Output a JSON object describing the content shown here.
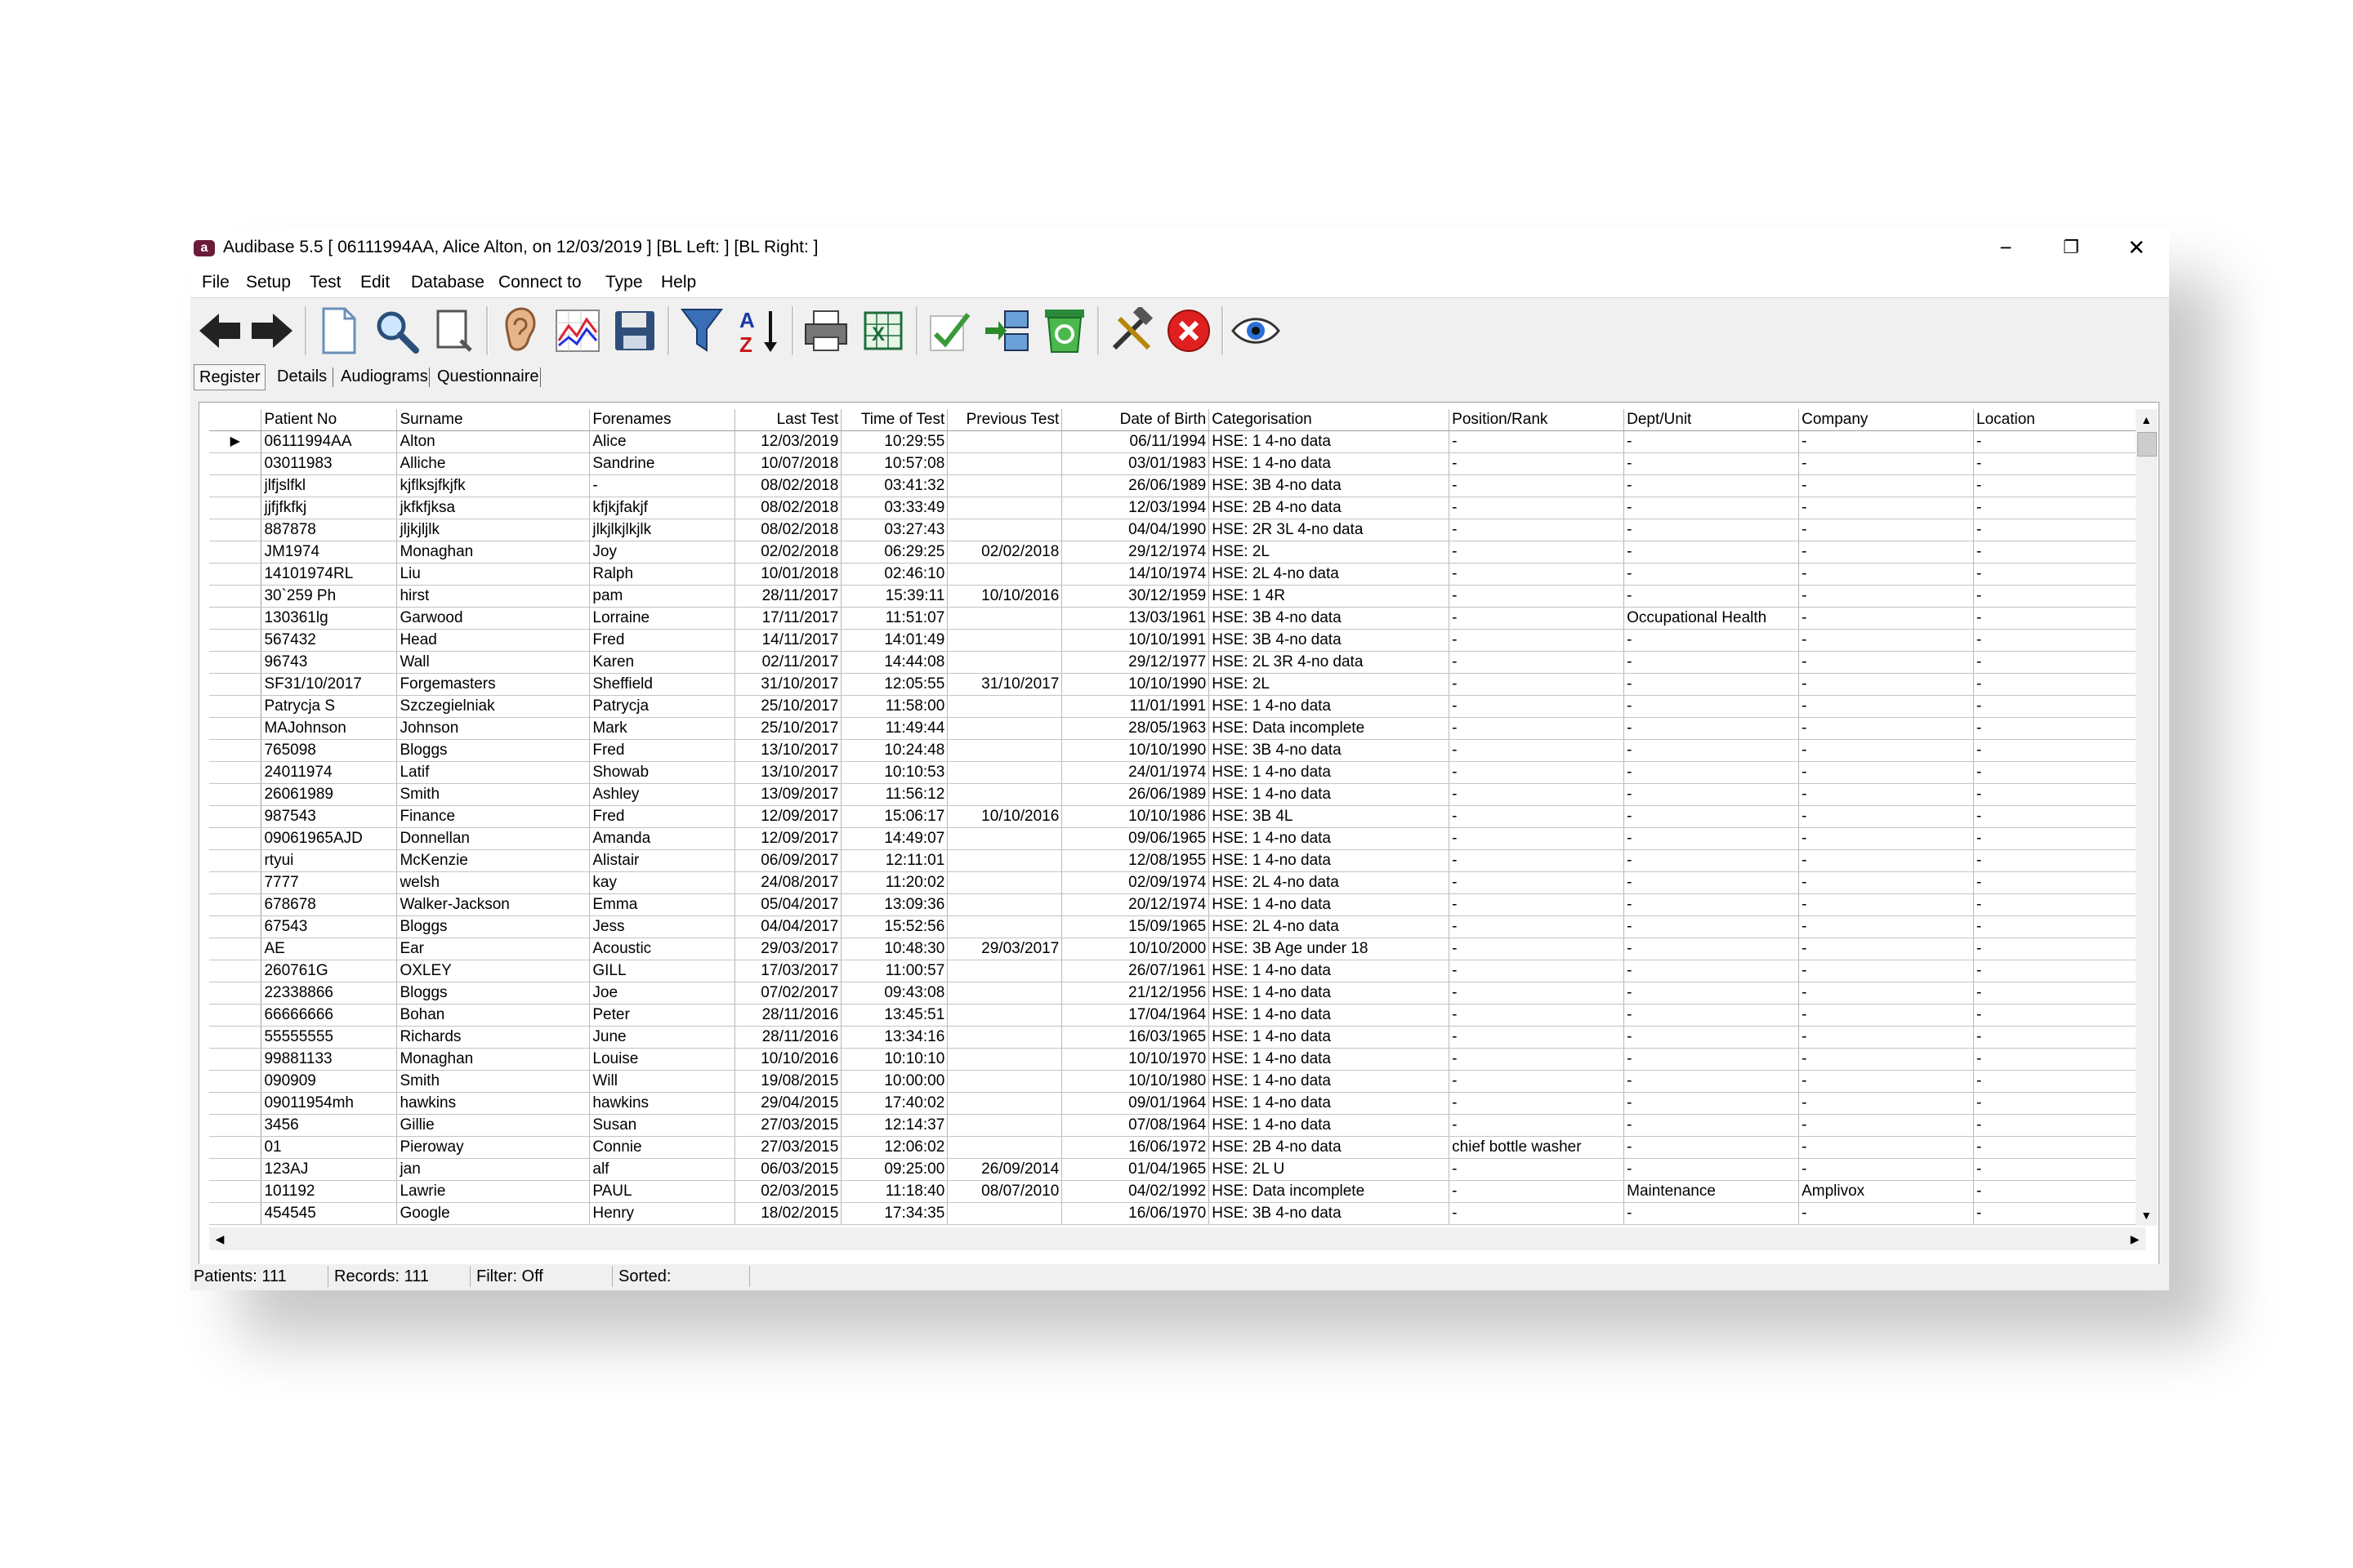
{
  "window": {
    "title": "Audibase 5.5 [ 06111994AA, Alice Alton, on 12/03/2019 ] [BL Left:  ] [BL Right:  ]",
    "app_icon_letter": "a",
    "controls": {
      "minimize": "−",
      "restore": "❐",
      "close": "✕"
    }
  },
  "menu": [
    "File",
    "Setup",
    "Test",
    "Edit",
    "Database",
    "Connect to",
    "Type",
    "Help"
  ],
  "toolbar": [
    {
      "name": "back-icon"
    },
    {
      "name": "forward-icon"
    },
    {
      "name": "new-document-icon"
    },
    {
      "name": "search-icon"
    },
    {
      "name": "preview-icon"
    },
    {
      "name": "ear-icon"
    },
    {
      "name": "audiogram-chart-icon"
    },
    {
      "name": "save-icon"
    },
    {
      "name": "filter-icon"
    },
    {
      "name": "sort-az-icon"
    },
    {
      "name": "print-icon"
    },
    {
      "name": "excel-export-icon"
    },
    {
      "name": "check-icon"
    },
    {
      "name": "transfer-icon"
    },
    {
      "name": "recycle-icon"
    },
    {
      "name": "tools-icon"
    },
    {
      "name": "cancel-icon"
    },
    {
      "name": "view-eye-icon"
    }
  ],
  "tabs": [
    "Register",
    "Details",
    "Audiograms",
    "Questionnaire"
  ],
  "grid": {
    "columns": [
      "Patient No",
      "Surname",
      "Forenames",
      "Last Test",
      "Time of Test",
      "Previous Test",
      "Date of Birth",
      "Categorisation",
      "Position/Rank",
      "Dept/Unit",
      "Company",
      "Location"
    ],
    "rows": [
      [
        "06111994AA",
        "Alton",
        "Alice",
        "12/03/2019",
        "10:29:55",
        "",
        "06/11/1994",
        "HSE:  1 4-no data",
        "-",
        "-",
        "-",
        "-"
      ],
      [
        "03011983",
        "Alliche",
        "Sandrine",
        "10/07/2018",
        "10:57:08",
        "",
        "03/01/1983",
        "HSE:  1 4-no data",
        "-",
        "-",
        "-",
        "-"
      ],
      [
        "jlfjslfkl",
        "kjflksjfkjfk",
        "-",
        "08/02/2018",
        "03:41:32",
        "",
        "26/06/1989",
        "HSE:  3B 4-no data",
        "-",
        "-",
        "-",
        "-"
      ],
      [
        "jjfjfkfkj",
        "jkfkfjksa",
        "kfjkjfakjf",
        "08/02/2018",
        "03:33:49",
        "",
        "12/03/1994",
        "HSE:  2B 4-no data",
        "-",
        "-",
        "-",
        "-"
      ],
      [
        "887878",
        "jljkjljlk",
        "jlkjlkjlkjlk",
        "08/02/2018",
        "03:27:43",
        "",
        "04/04/1990",
        "HSE:  2R 3L 4-no data",
        "-",
        "-",
        "-",
        "-"
      ],
      [
        "JM1974",
        "Monaghan",
        "Joy",
        "02/02/2018",
        "06:29:25",
        "02/02/2018",
        "29/12/1974",
        "HSE:  2L",
        "-",
        "-",
        "-",
        "-"
      ],
      [
        "14101974RL",
        "Liu",
        "Ralph",
        "10/01/2018",
        "02:46:10",
        "",
        "14/10/1974",
        "HSE:  2L 4-no data",
        "-",
        "-",
        "-",
        "-"
      ],
      [
        "30`259 Ph",
        "hirst",
        "pam",
        "28/11/2017",
        "15:39:11",
        "10/10/2016",
        "30/12/1959",
        "HSE:  1 4R",
        "-",
        "-",
        "-",
        "-"
      ],
      [
        "130361lg",
        "Garwood",
        "Lorraine",
        "17/11/2017",
        "11:51:07",
        "",
        "13/03/1961",
        "HSE:  3B 4-no data",
        "-",
        "Occupational Health",
        "-",
        "-"
      ],
      [
        "567432",
        "Head",
        "Fred",
        "14/11/2017",
        "14:01:49",
        "",
        "10/10/1991",
        "HSE:  3B 4-no data",
        "-",
        "-",
        "-",
        "-"
      ],
      [
        "96743",
        "Wall",
        "Karen",
        "02/11/2017",
        "14:44:08",
        "",
        "29/12/1977",
        "HSE:  2L 3R 4-no data",
        "-",
        "-",
        "-",
        "-"
      ],
      [
        "SF31/10/2017",
        "Forgemasters",
        "Sheffield",
        "31/10/2017",
        "12:05:55",
        "31/10/2017",
        "10/10/1990",
        "HSE:  2L",
        "-",
        "-",
        "-",
        "-"
      ],
      [
        "Patrycja S",
        "Szczegielniak",
        "Patrycja",
        "25/10/2017",
        "11:58:00",
        "",
        "11/01/1991",
        "HSE:  1 4-no data",
        "-",
        "-",
        "-",
        "-"
      ],
      [
        "MAJohnson",
        "Johnson",
        "Mark",
        "25/10/2017",
        "11:49:44",
        "",
        "28/05/1963",
        "HSE: Data incomplete",
        "-",
        "-",
        "-",
        "-"
      ],
      [
        "765098",
        "Bloggs",
        "Fred",
        "13/10/2017",
        "10:24:48",
        "",
        "10/10/1990",
        "HSE:  3B 4-no data",
        "-",
        "-",
        "-",
        "-"
      ],
      [
        "24011974",
        "Latif",
        "Showab",
        "13/10/2017",
        "10:10:53",
        "",
        "24/01/1974",
        "HSE:  1 4-no data",
        "-",
        "-",
        "-",
        "-"
      ],
      [
        "26061989",
        "Smith",
        "Ashley",
        "13/09/2017",
        "11:56:12",
        "",
        "26/06/1989",
        "HSE:  1 4-no data",
        "-",
        "-",
        "-",
        "-"
      ],
      [
        "987543",
        "Finance",
        "Fred",
        "12/09/2017",
        "15:06:17",
        "10/10/2016",
        "10/10/1986",
        "HSE:  3B 4L",
        "-",
        "-",
        "-",
        "-"
      ],
      [
        "09061965AJD",
        "Donnellan",
        "Amanda",
        "12/09/2017",
        "14:49:07",
        "",
        "09/06/1965",
        "HSE:  1 4-no data",
        "-",
        "-",
        "-",
        "-"
      ],
      [
        "rtyui",
        "McKenzie",
        "Alistair",
        "06/09/2017",
        "12:11:01",
        "",
        "12/08/1955",
        "HSE:  1 4-no data",
        "-",
        "-",
        "-",
        "-"
      ],
      [
        "7777",
        "welsh",
        "kay",
        "24/08/2017",
        "11:20:02",
        "",
        "02/09/1974",
        "HSE:  2L 4-no data",
        "-",
        "-",
        "-",
        "-"
      ],
      [
        "678678",
        "Walker-Jackson",
        "Emma",
        "05/04/2017",
        "13:09:36",
        "",
        "20/12/1974",
        "HSE:  1 4-no data",
        "-",
        "-",
        "-",
        "-"
      ],
      [
        "67543",
        "Bloggs",
        "Jess",
        "04/04/2017",
        "15:52:56",
        "",
        "15/09/1965",
        "HSE:  2L 4-no data",
        "-",
        "-",
        "-",
        "-"
      ],
      [
        "AE",
        "Ear",
        "Acoustic",
        "29/03/2017",
        "10:48:30",
        "29/03/2017",
        "10/10/2000",
        "HSE:  3B  Age under 18",
        "-",
        "-",
        "-",
        "-"
      ],
      [
        "260761G",
        "OXLEY",
        "GILL",
        "17/03/2017",
        "11:00:57",
        "",
        "26/07/1961",
        "HSE:  1 4-no data",
        "-",
        "-",
        "-",
        "-"
      ],
      [
        "22338866",
        "Bloggs",
        "Joe",
        "07/02/2017",
        "09:43:08",
        "",
        "21/12/1956",
        "HSE:  1 4-no data",
        "-",
        "-",
        "-",
        "-"
      ],
      [
        "66666666",
        "Bohan",
        "Peter",
        "28/11/2016",
        "13:45:51",
        "",
        "17/04/1964",
        "HSE:  1 4-no data",
        "-",
        "-",
        "-",
        "-"
      ],
      [
        "55555555",
        "Richards",
        "June",
        "28/11/2016",
        "13:34:16",
        "",
        "16/03/1965",
        "HSE:  1 4-no data",
        "-",
        "-",
        "-",
        "-"
      ],
      [
        "99881133",
        "Monaghan",
        "Louise",
        "10/10/2016",
        "10:10:10",
        "",
        "10/10/1970",
        "HSE:  1 4-no data",
        "-",
        "-",
        "-",
        "-"
      ],
      [
        "090909",
        "Smith",
        "Will",
        "19/08/2015",
        "10:00:00",
        "",
        "10/10/1980",
        "HSE:  1 4-no data",
        "-",
        "-",
        "-",
        "-"
      ],
      [
        "09011954mh",
        "hawkins",
        "hawkins",
        "29/04/2015",
        "17:40:02",
        "",
        "09/01/1964",
        "HSE:  1 4-no data",
        "-",
        "-",
        "-",
        "-"
      ],
      [
        "3456",
        "Gillie",
        "Susan",
        "27/03/2015",
        "12:14:37",
        "",
        "07/08/1964",
        "HSE:  1 4-no data",
        "-",
        "-",
        "-",
        "-"
      ],
      [
        "01",
        "Pieroway",
        "Connie",
        "27/03/2015",
        "12:06:02",
        "",
        "16/06/1972",
        "HSE:  2B 4-no data",
        "chief bottle washer",
        "-",
        "-",
        "-"
      ],
      [
        "123AJ",
        "jan",
        "alf",
        "06/03/2015",
        "09:25:00",
        "26/09/2014",
        "01/04/1965",
        "HSE:  2L U",
        "-",
        "-",
        "-",
        "-"
      ],
      [
        "101192",
        "Lawrie",
        "PAUL",
        "02/03/2015",
        "11:18:40",
        "08/07/2010",
        "04/02/1992",
        "HSE: Data incomplete",
        "-",
        "Maintenance",
        "Amplivox",
        "-"
      ],
      [
        "454545",
        "Google",
        "Henry",
        "18/02/2015",
        "17:34:35",
        "",
        "16/06/1970",
        "HSE:  3B 4-no data",
        "-",
        "-",
        "-",
        "-"
      ]
    ]
  },
  "status": {
    "patients": "Patients:  111",
    "records": "Records:  111",
    "filter": "Filter: Off",
    "sorted": "Sorted:"
  }
}
